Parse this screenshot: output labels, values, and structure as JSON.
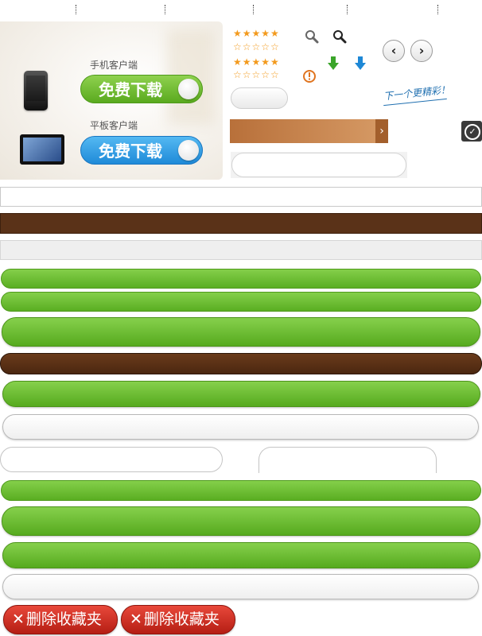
{
  "promo": {
    "phone_label": "手机客户端",
    "tablet_label": "平板客户端",
    "phone_button": "免费下载",
    "tablet_button": "免费下载"
  },
  "icons": {
    "star_full": "★★★★★",
    "star_empty": "☆☆☆☆☆",
    "search_icon": "search-icon",
    "warning_icon": "warning-icon",
    "arrow_left": "‹",
    "arrow_right": "›",
    "next_arrow": "›",
    "check": "✓",
    "green_arrow_color": "#3aa52a",
    "blue_arrow_color": "#1e88d6",
    "warning_color": "#e0741f"
  },
  "handwriting": "下一个更精彩！",
  "delete_buttons": [
    {
      "x": "✕",
      "label": "删除收藏夹"
    },
    {
      "x": "✕",
      "label": "删除收藏夹"
    }
  ],
  "colors": {
    "green": "#5aae22",
    "brown": "#5a3218",
    "blue": "#1f8ad8",
    "red": "#c52a1e",
    "orange": "#f39a1d"
  }
}
